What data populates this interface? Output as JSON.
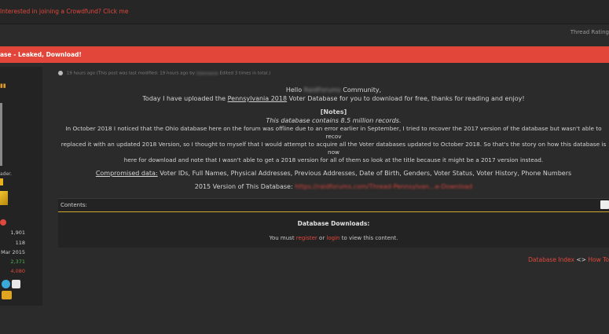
{
  "topbar": {
    "announcement": "Interested in joining a Crowdfund? Click me"
  },
  "thread": {
    "rating": "Thread Rating",
    "title": "ase - Leaked, Download!"
  },
  "sidebar": {
    "stats": [
      {
        "value": "1,901",
        "color": "#cfcfcf"
      },
      {
        "value": "118",
        "color": "#cfcfcf"
      },
      {
        "value": "Mar 2015",
        "color": "#cfcfcf"
      },
      {
        "value": "2,371",
        "color": "#4caf50"
      },
      {
        "value": "4,080",
        "color": "#e0483c"
      }
    ],
    "rank": "ader."
  },
  "post": {
    "meta": {
      "time": "19 hours ago",
      "edited": "(This post was last modified: 19 hours ago by",
      "edits": "Edited 3 times in total.)"
    },
    "greeting_pre": "Hello",
    "greeting_post": "Community,",
    "intro_pre": "Today I have uploaded the",
    "intro_state": "Pennsylvania 2018",
    "intro_post": "Voter Database for you to download for free, thanks for reading and enjoy!",
    "notes_label": "[Notes]",
    "records": "This database contains 8.5 million records.",
    "paragraph_1": "In October 2018 I noticed that the Ohio database here on the forum was offline due to an error earlier in September, I tried to recover the 2017 version of the database but wasn't able to recov",
    "paragraph_2": "replaced it with an updated 2018 Version, so I thought to myself that I would attempt to acquire all the Voter databases updated to October 2018. So that's the story on how this database is now",
    "paragraph_3": "here for download and note that I wasn't able to get a 2018 version for all of them so look at the title because it might be a 2017 version instead.",
    "compromised_label": "Compromised data:",
    "compromised_values": "Voter IDs, Full Names, Physical Addresses, Previous Addresses, Date of Birth, Genders, Voter Status, Voter History, Phone Numbers",
    "version_label": "2015 Version of This Database:",
    "version_link": "https://raidforums.com/Thread-Pennsylvan...e-Download"
  },
  "contents": {
    "label": "Contents:"
  },
  "downloads": {
    "heading": "Database Downloads:",
    "msg_pre": "You must",
    "register": "register",
    "msg_mid": "or",
    "login": "login",
    "msg_post": "to view this content."
  },
  "footer": {
    "link_1": "Database Index",
    "separator": "<>",
    "link_2": "How To"
  },
  "colors": {
    "accent": "#e2463a",
    "panel": "#232323",
    "background": "#2b2b2b"
  }
}
